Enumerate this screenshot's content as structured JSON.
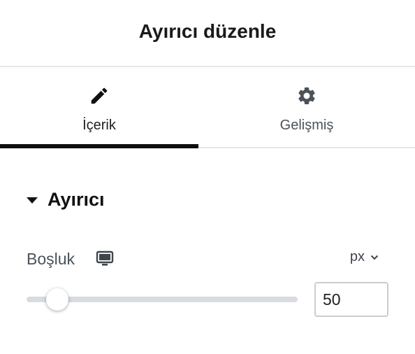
{
  "header": {
    "title": "Ayırıcı düzenle"
  },
  "tabs": [
    {
      "label": "İçerik",
      "icon": "pencil-icon",
      "active": true
    },
    {
      "label": "Gelişmiş",
      "icon": "gear-icon",
      "active": false
    }
  ],
  "section": {
    "title": "Ayırıcı",
    "expanded": true
  },
  "spacing_control": {
    "label": "Boşluk",
    "device_icon": "desktop-icon",
    "unit": "px",
    "value": "50",
    "slider_fraction": 0.08
  },
  "colors": {
    "accent": "#0e0e0e",
    "divider": "#e6e8ea",
    "icon": "#4b5259"
  }
}
